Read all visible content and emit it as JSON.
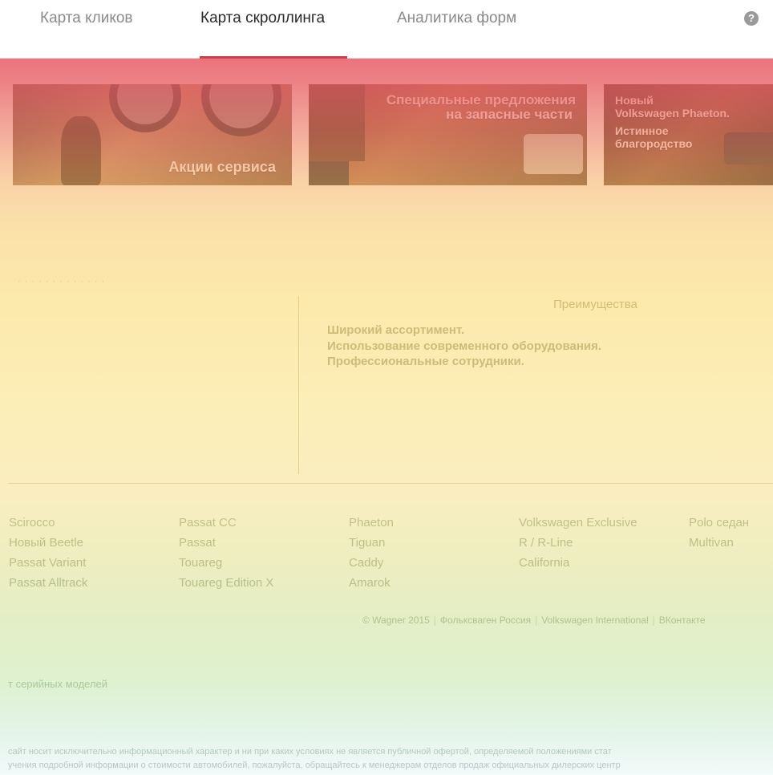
{
  "tabs": [
    {
      "label": "Карта кликов",
      "active": false
    },
    {
      "label": "Карта скроллинга",
      "active": true
    },
    {
      "label": "Аналитика форм",
      "active": false
    }
  ],
  "help_icon": "question-circle-icon",
  "colors": {
    "accent": "#c8424a",
    "heat_top": "#e85a64",
    "heat_mid": "#f8d06e",
    "heat_bottom": "#cdebd7"
  },
  "banners": {
    "service": "Акции сервиса",
    "parts_line1": "Специальные предложения",
    "parts_line2": "на запасные части",
    "phaeton_line1": "Новый",
    "phaeton_line2": "Volkswagen Phaeton.",
    "phaeton_line3": "Истинное",
    "phaeton_line4": "благородство"
  },
  "advantages": {
    "title": "Преимущества",
    "lines": [
      "Широкий ассортимент.",
      "Использование современного оборудования.",
      "Профессиональные сотрудники."
    ]
  },
  "models": [
    [
      "Scirocco",
      "Новый Beetle",
      "Passat Variant",
      "Passat Alltrack"
    ],
    [
      "Passat CC",
      "Passat",
      "Touareg",
      "Touareg Edition X"
    ],
    [
      "Phaeton",
      "Tiguan",
      "Caddy",
      "Amarok"
    ],
    [
      "Volkswagen Exclusive",
      "R / R-Line",
      "California"
    ],
    [
      "Polo седан",
      "Multivan"
    ]
  ],
  "footer": {
    "copyright": "© Wagner 2015",
    "link1": "Фольксваген Россия",
    "link2": "Volkswagen International",
    "link3": "ВКонтакте"
  },
  "serial_link": "т серийных моделей",
  "disclaimer": {
    "line1": "сайт носит исключительно информационный характер и ни при каких условиях не является публичной офертой, определяемой положениями стат",
    "line2": "учения подробной информации о стоимости автомобилей, пожалуйста, обращайтесь к менеджерам отделов продаж официальных дилерских центр"
  }
}
